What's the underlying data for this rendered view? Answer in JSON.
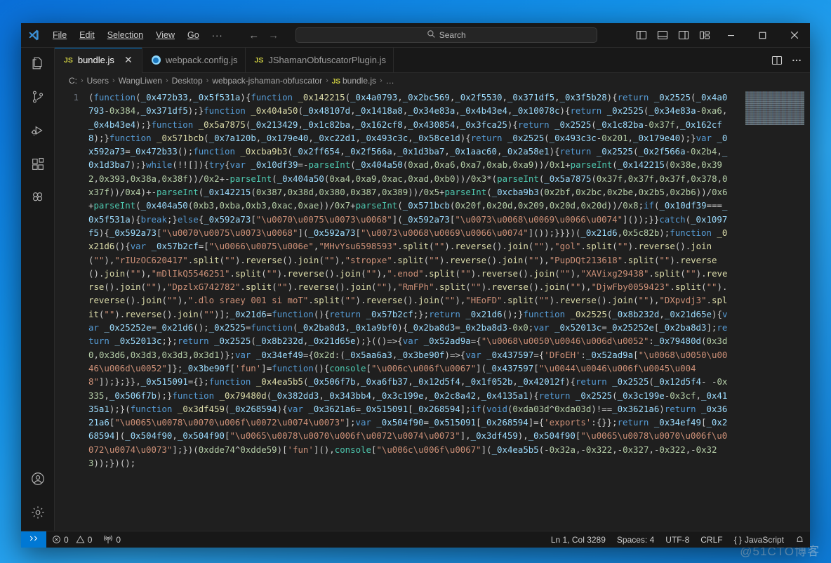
{
  "window": {
    "logo": "vscode-logo",
    "menu": [
      {
        "label": "File",
        "mnemonic": "F"
      },
      {
        "label": "Edit",
        "mnemonic": "E"
      },
      {
        "label": "Selection",
        "mnemonic": "S"
      },
      {
        "label": "View",
        "mnemonic": "V"
      },
      {
        "label": "Go",
        "mnemonic": "G"
      },
      {
        "label": "···",
        "mnemonic": ""
      }
    ],
    "nav": {
      "back": "←",
      "forward": "→"
    },
    "search": {
      "placeholder": "Search",
      "value": "",
      "icon": "search-icon"
    },
    "layout_buttons": [
      {
        "name": "toggle-primary-sidebar-icon",
        "title": "Toggle Primary Side Bar"
      },
      {
        "name": "toggle-panel-icon",
        "title": "Toggle Panel"
      },
      {
        "name": "toggle-secondary-sidebar-icon",
        "title": "Toggle Secondary Side Bar"
      },
      {
        "name": "customize-layout-icon",
        "title": "Customize Layout"
      }
    ],
    "controls": {
      "minimize": "—",
      "maximize": "□",
      "close": "✕"
    }
  },
  "activitybar": {
    "items": [
      {
        "name": "explorer",
        "label": "Explorer",
        "icon": "files-icon"
      },
      {
        "name": "source-control",
        "label": "Source Control",
        "icon": "source-control-icon"
      },
      {
        "name": "run-and-debug",
        "label": "Run and Debug",
        "icon": "run-debug-icon"
      },
      {
        "name": "extensions",
        "label": "Extensions",
        "icon": "extensions-icon"
      },
      {
        "name": "figma",
        "label": "Figma",
        "icon": "figma-icon"
      }
    ],
    "bottom": [
      {
        "name": "accounts",
        "label": "Accounts",
        "icon": "account-icon"
      },
      {
        "name": "manage",
        "label": "Manage",
        "icon": "gear-icon"
      }
    ]
  },
  "tabs": [
    {
      "label": "bundle.js",
      "icon": "js-file-icon",
      "icon_text": "JS",
      "active": true,
      "closable": true,
      "close": "✕"
    },
    {
      "label": "webpack.config.js",
      "icon": "webpack-file-icon",
      "icon_text": "",
      "active": false,
      "closable": false,
      "close": ""
    },
    {
      "label": "JShamanObfuscatorPlugin.js",
      "icon": "js-file-icon",
      "icon_text": "JS",
      "active": false,
      "closable": false,
      "close": ""
    }
  ],
  "tabbar_actions": [
    {
      "name": "split-editor-icon",
      "label": "Split Editor"
    },
    {
      "name": "more-actions-icon",
      "label": "More Actions..."
    }
  ],
  "breadcrumbs": {
    "separator": "›",
    "items": [
      {
        "label": "C:",
        "icon": ""
      },
      {
        "label": "Users",
        "icon": ""
      },
      {
        "label": "WangLiwen",
        "icon": ""
      },
      {
        "label": "Desktop",
        "icon": ""
      },
      {
        "label": "webpack-jshaman-obfuscator",
        "icon": ""
      },
      {
        "label": "bundle.js",
        "icon": "JS"
      },
      {
        "label": "…",
        "icon": ""
      }
    ]
  },
  "editor": {
    "line_numbers": [
      "1"
    ],
    "code": "(function(_0x472b33,_0x5f531a){function _0x142215(_0x4a0793,_0x2bc569,_0x2f5530,_0x371df5,_0x3f5b28){return _0x2525(_0x4a0793-0x384,_0x371df5);}function _0x404a50(_0x48107d,_0x1418a8,_0x34e83a,_0x4b43e4,_0x10078c){return _0x2525(_0x34e83a-0xa6,_0x4b43e4);}function _0x5a7875(_0x213429,_0x1c82ba,_0x162cf8,_0x430854,_0x3fca25){return _0x2525(_0x1c82ba-0x37f,_0x162cf8);}function _0x571bcb(_0x7a120b,_0x179e40,_0xc22d1,_0x493c3c,_0x58ce1d){return _0x2525(_0x493c3c-0x201,_0x179e40);}var _0x592a73=_0x472b33();function _0xcba9b3(_0x2ff654,_0x2f566a,_0x1d3ba7,_0x1aac60,_0x2a58e1){return _0x2525(_0x2f566a-0x2b4,_0x1d3ba7);}while(!![]){try{var _0x10df39=-parseInt(_0x404a50(0xad,0xa6,0xa7,0xab,0xa9))/0x1+parseInt(_0x142215(0x38e,0x392,0x393,0x38a,0x38f))/0x2+-parseInt(_0x404a50(0xa4,0xa9,0xac,0xad,0xb0))/0x3*(parseInt(_0x5a7875(0x37f,0x37f,0x37f,0x378,0x37f))/0x4)+-parseInt(_0x142215(0x387,0x38d,0x380,0x387,0x389))/0x5+parseInt(_0xcba9b3(0x2bf,0x2bc,0x2be,0x2b5,0x2b6))/0x6+parseInt(_0x404a50(0xb3,0xba,0xb3,0xac,0xae))/0x7+parseInt(_0x571bcb(0x20f,0x20d,0x209,0x20d,0x20d))/0x8;if(_0x10df39===_0x5f531a){break;}else{_0x592a73[\"\\u0070\\u0075\\u0073\\u0068\"](_0x592a73[\"\\u0073\\u0068\\u0069\\u0066\\u0074\"]());}}catch(_0x1097f5){_0x592a73[\"\\u0070\\u0075\\u0073\\u0068\"](_0x592a73[\"\\u0073\\u0068\\u0069\\u0066\\u0074\"]());}}})(_0x21d6,0x5c82b);function _0x21d6(){var _0x57b2cf=[\"\\u0066\\u0075\\u006e\",\"MHvYsu6598593\".split(\"\").reverse().join(\"\"),\"gol\".split(\"\").reverse().join(\"\"),\"rIUzOC620417\".split(\"\").reverse().join(\"\"),\"stropxe\".split(\"\").reverse().join(\"\"),\"PupDQt213618\".split(\"\").reverse().join(\"\"),\"mDlIkQ5546251\".split(\"\").reverse().join(\"\"),\".enod\".split(\"\").reverse().join(\"\"),\"XAVixg29438\".split(\"\").reverse().join(\"\"),\"DpzlxG742782\".split(\"\").reverse().join(\"\"),\"RmFPh\".split(\"\").reverse().join(\"\"),\"DjwFby0059423\".split(\"\").reverse().join(\"\"),\".dlo sraey 001 si moT\".split(\"\").reverse().join(\"\"),\"HEoFD\".split(\"\").reverse().join(\"\"),\"DXpvdj3\".split(\"\").reverse().join(\"\")];_0x21d6=function(){return _0x57b2cf;};return _0x21d6();}function _0x2525(_0x8b232d,_0x21d65e){var _0x25252e=_0x21d6();_0x2525=function(_0x2ba8d3,_0x1a9bf0){_0x2ba8d3=_0x2ba8d3-0x0;var _0x52013c=_0x25252e[_0x2ba8d3];return _0x52013c;};return _0x2525(_0x8b232d,_0x21d65e);}(()=>{var _0x52ad9a={\"\\u0068\\u0050\\u0046\\u006d\\u0052\":_0x79480d(0x3d0,0x3d6,0x3d3,0x3d3,0x3d1)};var _0x34ef49={0x2d:(_0x5aa6a3,_0x3be90f)=>{var _0x437597={'DFoEH':_0x52ad9a[\"\\u0068\\u0050\\u0046\\u006d\\u0052\"]};_0x3be90f['fun']=function(){console[\"\\u006c\\u006f\\u0067\"](_0x437597[\"\\u0044\\u0046\\u006f\\u0045\\u0048\"]);};}},_0x515091={};function _0x4ea5b5(_0x506f7b,_0xa6fb37,_0x12d5f4,_0x1f052b,_0x42012f){return _0x2525(_0x12d5f4- -0x335,_0x506f7b);}function _0x79480d(_0x382dd3,_0x343bb4,_0x3c199e,_0x2c8a42,_0x4135a1){return _0x2525(_0x3c199e-0x3cf,_0x4135a1);}(function _0x3df459(_0x268594){var _0x3621a6=_0x515091[_0x268594];if(void(0xda03d^0xda03d)!==_0x3621a6)return _0x3621a6[\"\\u0065\\u0078\\u0070\\u006f\\u0072\\u0074\\u0073\"];var _0x504f90=_0x515091[_0x268594]={'exports':{}};return _0x34ef49[_0x268594](_0x504f90,_0x504f90[\"\\u0065\\u0078\\u0070\\u006f\\u0072\\u0074\\u0073\"],_0x3df459),_0x504f90[\"\\u0065\\u0078\\u0070\\u006f\\u0072\\u0074\\u0073\"];})(0xdde74^0xdde59)['fun'](),console[\"\\u006c\\u006f\\u0067\"](_0x4ea5b5(-0x32a,-0x322,-0x327,-0x322,-0x323));})();"
  },
  "statusbar": {
    "remote": {
      "name": "remote-indicator",
      "icon": "remote-icon"
    },
    "left": [
      {
        "name": "problems-errors",
        "icon": "error-icon",
        "label": "0"
      },
      {
        "name": "problems-warnings",
        "icon": "warning-icon",
        "label": "0"
      },
      {
        "name": "ports",
        "icon": "radio-tower-icon",
        "label": "0"
      }
    ],
    "right": [
      {
        "name": "editor-position",
        "label": "Ln 1, Col 3289"
      },
      {
        "name": "editor-indentation",
        "label": "Spaces: 4"
      },
      {
        "name": "editor-encoding",
        "label": "UTF-8"
      },
      {
        "name": "editor-eol",
        "label": "CRLF"
      },
      {
        "name": "editor-language",
        "label": "JavaScript",
        "prefix": "{ }"
      },
      {
        "name": "notifications-bell",
        "label": "",
        "icon": "bell-icon"
      }
    ]
  },
  "watermark": {
    "text": "@51CTO博客"
  },
  "colors": {
    "accent": "#0078d4",
    "titlebar_bg": "#181818",
    "editor_bg": "#1f1f1f",
    "statusbar_bg": "#181818",
    "desktop": "#1391e8",
    "js_icon": "#cbcb41"
  }
}
